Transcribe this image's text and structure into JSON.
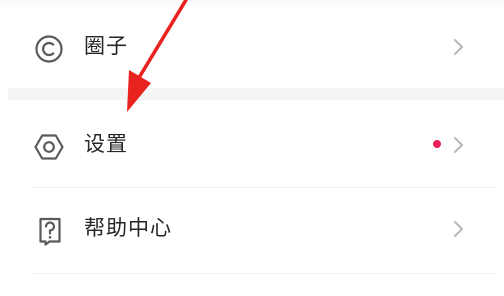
{
  "menu": {
    "items": [
      {
        "label": "圈子",
        "icon": "circle-c-icon",
        "has_chevron": true
      },
      {
        "label": "设置",
        "icon": "hexagon-gear-icon",
        "badge": "red-dot",
        "has_chevron": true
      },
      {
        "label": "帮助中心",
        "icon": "help-question-icon",
        "has_chevron": true
      }
    ]
  },
  "colors": {
    "text": "#262626",
    "icon": "#5a5a5a",
    "chevron": "#b8b8b8",
    "badge": "#ee1f5d",
    "arrow": "#e8231f",
    "divider": "#f5f5f5"
  },
  "annotation": {
    "type": "arrow",
    "target": "设置",
    "color": "#e8231f"
  }
}
